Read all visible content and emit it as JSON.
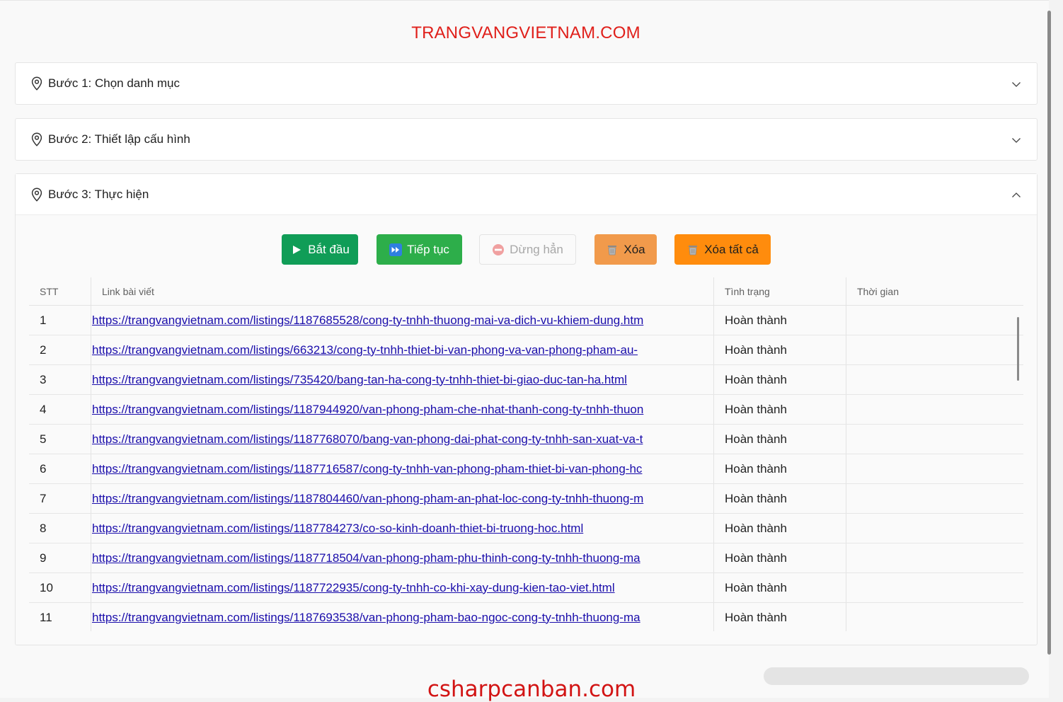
{
  "app": {
    "title": "TRANGVANGVIETNAM.COM",
    "watermark": "csharpcanban.com"
  },
  "steps": [
    {
      "label": "Bước 1: Chọn danh mục",
      "expanded": false
    },
    {
      "label": "Bước 2: Thiết lập cấu hình",
      "expanded": false
    },
    {
      "label": "Bước 3: Thực hiện",
      "expanded": true
    }
  ],
  "toolbar": {
    "start_label": "Bắt đầu",
    "continue_label": "Tiếp tục",
    "stop_label": "Dừng hẳn",
    "delete_label": "Xóa",
    "delete_all_label": "Xóa tất cả"
  },
  "table": {
    "columns": [
      "STT",
      "Link bài viết",
      "Tình trạng",
      "Thời gian"
    ],
    "rows": [
      {
        "stt": "1",
        "link": "https://trangvangvietnam.com/listings/1187685528/cong-ty-tnhh-thuong-mai-va-dich-vu-khiem-dung.htm",
        "status": "Hoàn thành",
        "time": ""
      },
      {
        "stt": "2",
        "link": "https://trangvangvietnam.com/listings/663213/cong-ty-tnhh-thiet-bi-van-phong-va-van-phong-pham-au-",
        "status": "Hoàn thành",
        "time": ""
      },
      {
        "stt": "3",
        "link": "https://trangvangvietnam.com/listings/735420/bang-tan-ha-cong-ty-tnhh-thiet-bi-giao-duc-tan-ha.html",
        "status": "Hoàn thành",
        "time": ""
      },
      {
        "stt": "4",
        "link": "https://trangvangvietnam.com/listings/1187944920/van-phong-pham-che-nhat-thanh-cong-ty-tnhh-thuon",
        "status": "Hoàn thành",
        "time": ""
      },
      {
        "stt": "5",
        "link": "https://trangvangvietnam.com/listings/1187768070/bang-van-phong-dai-phat-cong-ty-tnhh-san-xuat-va-t",
        "status": "Hoàn thành",
        "time": ""
      },
      {
        "stt": "6",
        "link": "https://trangvangvietnam.com/listings/1187716587/cong-ty-tnhh-van-phong-pham-thiet-bi-van-phong-hc",
        "status": "Hoàn thành",
        "time": ""
      },
      {
        "stt": "7",
        "link": "https://trangvangvietnam.com/listings/1187804460/van-phong-pham-an-phat-loc-cong-ty-tnhh-thuong-m",
        "status": "Hoàn thành",
        "time": ""
      },
      {
        "stt": "8",
        "link": "https://trangvangvietnam.com/listings/1187784273/co-so-kinh-doanh-thiet-bi-truong-hoc.html",
        "status": "Hoàn thành",
        "time": ""
      },
      {
        "stt": "9",
        "link": "https://trangvangvietnam.com/listings/1187718504/van-phong-pham-phu-thinh-cong-ty-tnhh-thuong-ma",
        "status": "Hoàn thành",
        "time": ""
      },
      {
        "stt": "10",
        "link": "https://trangvangvietnam.com/listings/1187722935/cong-ty-tnhh-co-khi-xay-dung-kien-tao-viet.html",
        "status": "Hoàn thành",
        "time": ""
      },
      {
        "stt": "11",
        "link": "https://trangvangvietnam.com/listings/1187693538/van-phong-pham-bao-ngoc-cong-ty-tnhh-thuong-ma",
        "status": "Hoàn thành",
        "time": ""
      }
    ]
  },
  "icons": {
    "step": "map-pin-icon",
    "collapsed": "chevron-down-icon",
    "expanded": "chevron-up-icon",
    "start": "play-icon",
    "continue": "fast-forward-icon",
    "stop": "no-entry-icon",
    "delete": "trash-icon"
  },
  "colors": {
    "title": "#e0201b",
    "start": "#109d57",
    "continue": "#2dae4a",
    "delete": "#f19a4b",
    "delete_all": "#ff8c0d",
    "link": "#1a0dab"
  }
}
